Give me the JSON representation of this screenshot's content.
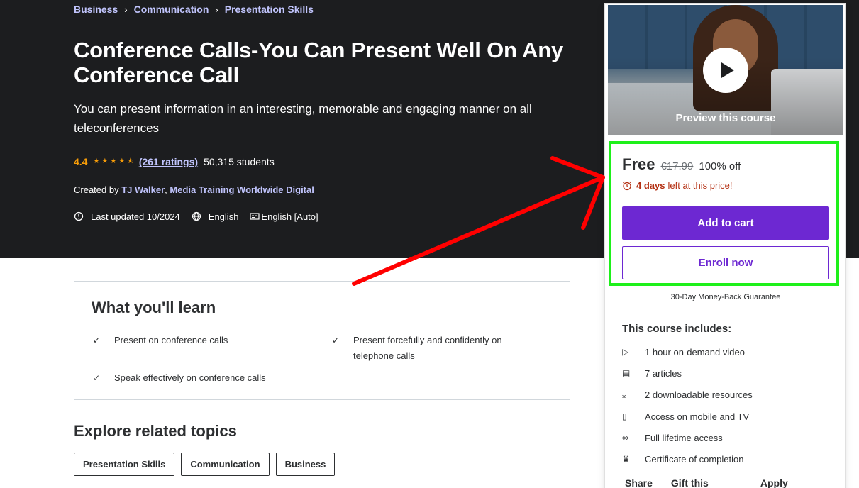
{
  "breadcrumb": [
    "Business",
    "Communication",
    "Presentation Skills"
  ],
  "course": {
    "title": "Conference Calls-You Can Present Well On Any Conference Call",
    "subtitle": "You can present information in an interesting, memorable and engaging manner on all teleconferences",
    "rating": "4.4",
    "stars": "★★★★⯪",
    "ratings_link": "(261 ratings)",
    "students": "50,315 students",
    "created_by_label": "Created by",
    "authors": [
      "TJ Walker",
      "Media Training Worldwide Digital"
    ],
    "author_sep": ",",
    "last_updated": "Last updated 10/2024",
    "language": "English",
    "captions": "English [Auto]"
  },
  "learn": {
    "title": "What you'll learn",
    "items": [
      "Present on conference calls",
      "Present forcefully and confidently on telephone calls",
      "Speak effectively on conference calls"
    ]
  },
  "explore": {
    "title": "Explore related topics",
    "topics": [
      "Presentation Skills",
      "Communication",
      "Business"
    ]
  },
  "card": {
    "preview_label": "Preview this course",
    "price": "Free",
    "old_price": "€17.99",
    "discount": "100% off",
    "timer_days": "4 days",
    "timer_text": "left at this price!",
    "add_to_cart": "Add to cart",
    "enroll_now": "Enroll now",
    "guarantee": "30-Day Money-Back Guarantee",
    "includes_title": "This course includes:",
    "includes": [
      {
        "icon": "video-icon",
        "glyph": "▷",
        "text": "1 hour on-demand video"
      },
      {
        "icon": "article-icon",
        "glyph": "▤",
        "text": "7 articles"
      },
      {
        "icon": "download-icon",
        "glyph": "⤓",
        "text": "2 downloadable resources"
      },
      {
        "icon": "mobile-icon",
        "glyph": "▯",
        "text": "Access on mobile and TV"
      },
      {
        "icon": "infinity-icon",
        "glyph": "∞",
        "text": "Full lifetime access"
      },
      {
        "icon": "trophy-icon",
        "glyph": "♛",
        "text": "Certificate of completion"
      }
    ],
    "links": [
      "Share",
      "Gift this course",
      "Apply Coupon"
    ]
  },
  "colors": {
    "accent": "#6d28d2",
    "hero_bg": "#1c1d1f",
    "link": "#c0c4fc",
    "star": "#f69c08",
    "timer": "#b32d0f",
    "annotation_box": "#1ef01a",
    "annotation_arrow": "#ff0000"
  }
}
